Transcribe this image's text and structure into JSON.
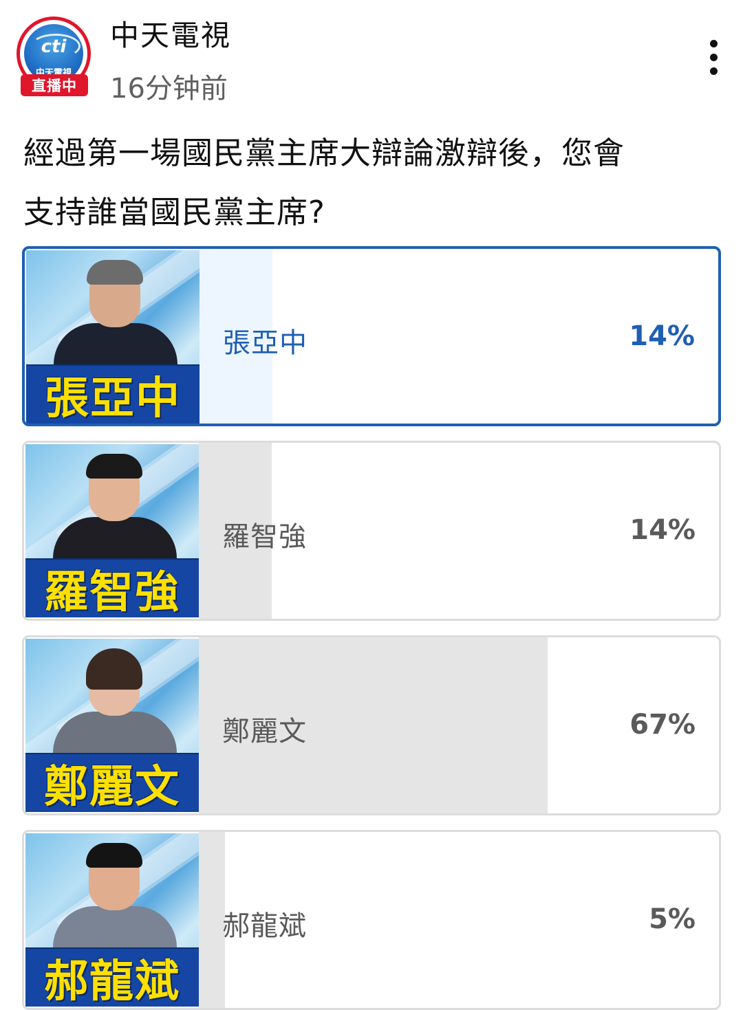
{
  "post": {
    "channel": "中天電視",
    "logo_text": "cti",
    "logo_brand": "中天電視",
    "live_badge": "直播中",
    "time": "16分钟前",
    "question_line1": "經過第一場國民黨主席大辯論激辯後，您會",
    "question_line2": "支持誰當國民黨主席?"
  },
  "poll": {
    "options": [
      {
        "name": "張亞中",
        "thumb_caption": "張亞中",
        "percent_label": "14%",
        "percent": 14,
        "selected": true
      },
      {
        "name": "羅智強",
        "thumb_caption": "羅智強",
        "percent_label": "14%",
        "percent": 14,
        "selected": false
      },
      {
        "name": "鄭麗文",
        "thumb_caption": "鄭麗文",
        "percent_label": "67%",
        "percent": 67,
        "selected": false
      },
      {
        "name": "郝龍斌",
        "thumb_caption": "郝龍斌",
        "percent_label": "5%",
        "percent": 5,
        "selected": false
      }
    ]
  },
  "colors": {
    "selected_accent": "#1f5fb3",
    "live_red": "#e0162b",
    "caption_yellow": "#fde000",
    "caption_blue": "#1546a3"
  }
}
